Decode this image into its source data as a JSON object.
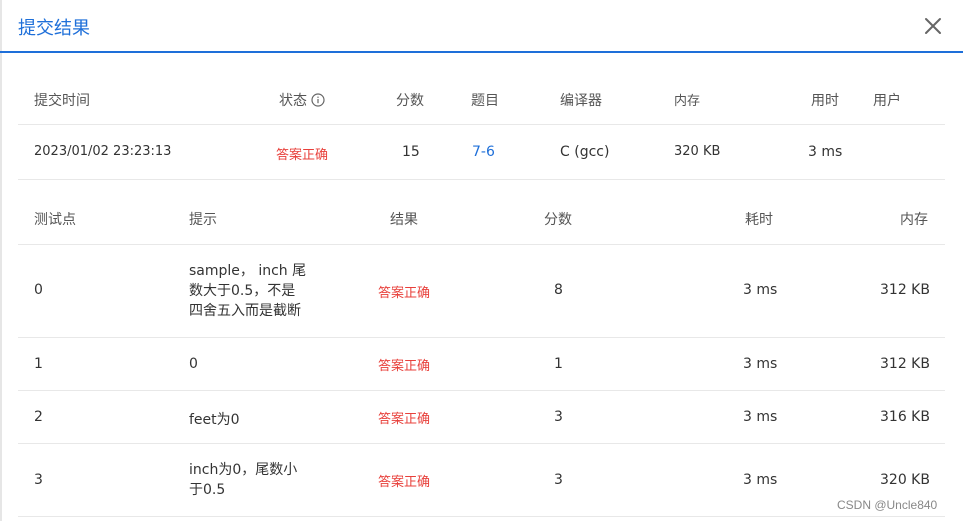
{
  "dialog": {
    "title": "提交结果"
  },
  "summary": {
    "headers": {
      "time": "提交时间",
      "status": "状态",
      "score": "分数",
      "problem": "题目",
      "compiler": "编译器",
      "memory": "内存",
      "duration": "用时",
      "user": "用户"
    },
    "row": {
      "time": "2023/01/02 23:23:13",
      "status": "答案正确",
      "score": "15",
      "problem": "7-6",
      "compiler": "C (gcc)",
      "memory": "320 KB",
      "duration": "3 ms",
      "user": ""
    }
  },
  "tests": {
    "headers": {
      "id": "测试点",
      "hint": "提示",
      "result": "结果",
      "score": "分数",
      "time": "耗时",
      "memory": "内存"
    },
    "rows": [
      {
        "id": "0",
        "hint_lines": [
          "sample， inch 尾",
          "数大于0.5，不是",
          "四舍五入而是截断"
        ],
        "result": "答案正确",
        "score": "8",
        "time": "3 ms",
        "memory": "312 KB"
      },
      {
        "id": "1",
        "hint_lines": [
          "0"
        ],
        "result": "答案正确",
        "score": "1",
        "time": "3 ms",
        "memory": "312 KB"
      },
      {
        "id": "2",
        "hint_lines": [
          "feet为0"
        ],
        "result": "答案正确",
        "score": "3",
        "time": "3 ms",
        "memory": "316 KB"
      },
      {
        "id": "3",
        "hint_lines": [
          "inch为0，尾数小",
          "于0.5"
        ],
        "result": "答案正确",
        "score": "3",
        "time": "3 ms",
        "memory": "320 KB"
      }
    ]
  },
  "watermark": "CSDN @Uncle840",
  "colors": {
    "accent": "#1e6fd9",
    "success_text": "#e8403b"
  },
  "icons": {
    "close": "close-icon",
    "info": "info-icon"
  }
}
